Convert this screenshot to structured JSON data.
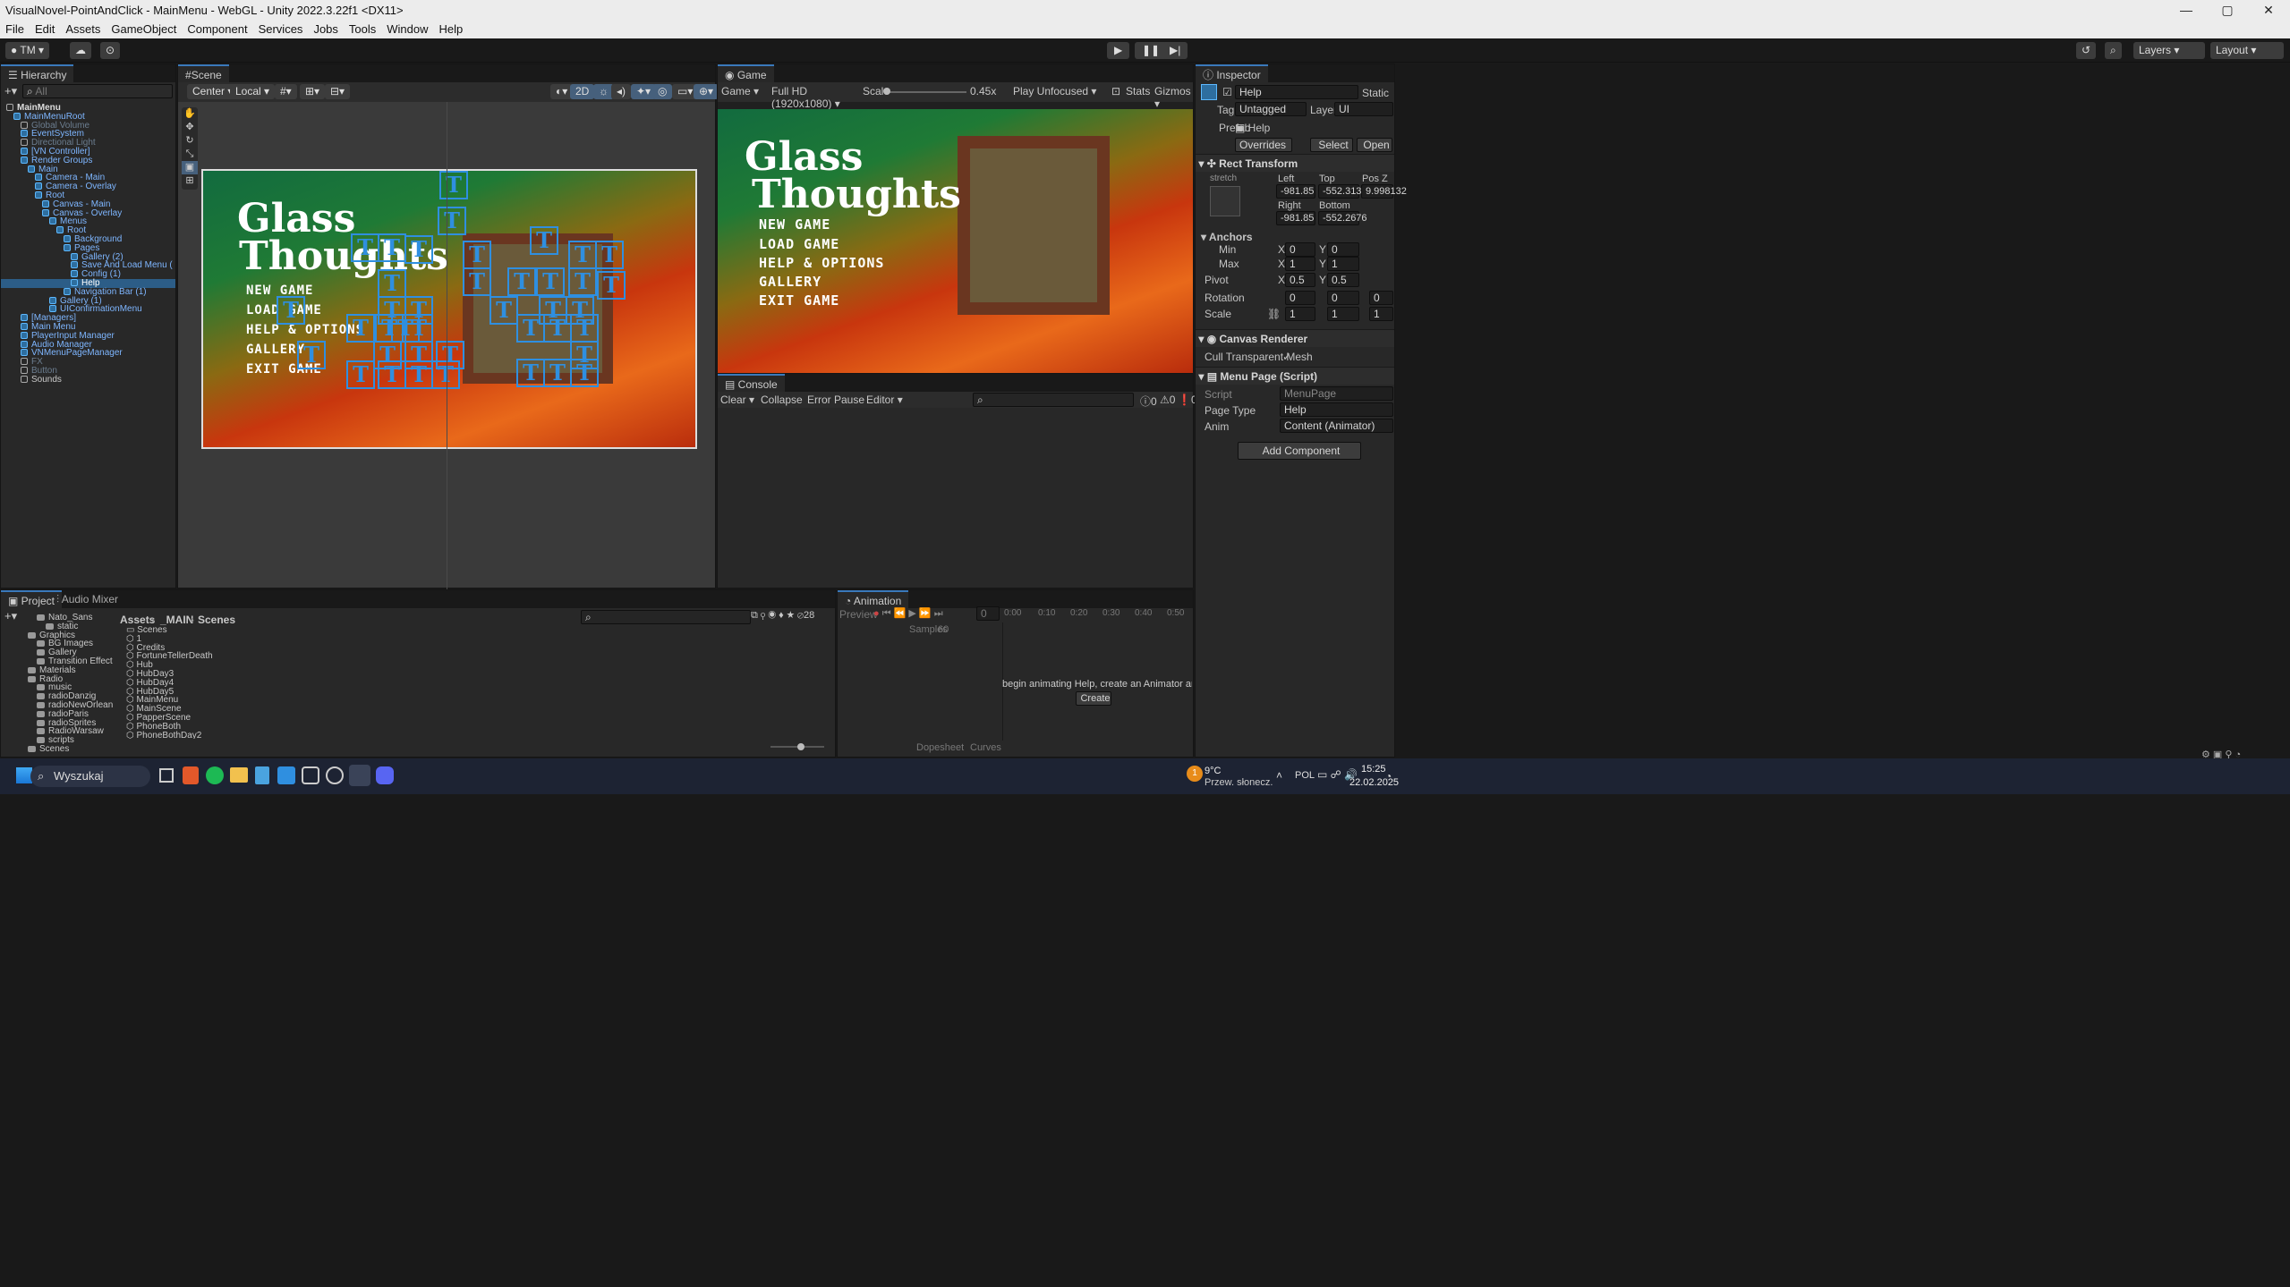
{
  "window": {
    "title": "VisualNovel-PointAndClick - MainMenu - WebGL - Unity 2022.3.22f1 <DX11>",
    "minimize": "—",
    "maximize": "▢",
    "close": "✕"
  },
  "menubar": [
    "File",
    "Edit",
    "Assets",
    "GameObject",
    "Component",
    "Services",
    "Jobs",
    "Tools",
    "Window",
    "Help"
  ],
  "toolbar": {
    "account": "TM",
    "layers": "Layers",
    "layout": "Layout"
  },
  "hierarchy": {
    "tab": "Hierarchy",
    "search_placeholder": "All",
    "items": [
      {
        "label": "MainMenu",
        "depth": 0,
        "type": "scene"
      },
      {
        "label": "MainMenuRoot",
        "depth": 1,
        "type": "prefab"
      },
      {
        "label": "Global Volume",
        "depth": 2,
        "type": "dim"
      },
      {
        "label": "EventSystem",
        "depth": 2,
        "type": "prefab"
      },
      {
        "label": "Directional Light",
        "depth": 2,
        "type": "dim"
      },
      {
        "label": "[VN Controller]",
        "depth": 2,
        "type": "prefab"
      },
      {
        "label": "Render Groups",
        "depth": 2,
        "type": "prefab"
      },
      {
        "label": "Main",
        "depth": 3,
        "type": "prefab"
      },
      {
        "label": "Camera - Main",
        "depth": 4,
        "type": "prefab"
      },
      {
        "label": "Camera - Overlay",
        "depth": 4,
        "type": "prefab"
      },
      {
        "label": "Root",
        "depth": 4,
        "type": "prefab"
      },
      {
        "label": "Canvas - Main",
        "depth": 5,
        "type": "prefab"
      },
      {
        "label": "Canvas - Overlay",
        "depth": 5,
        "type": "prefab"
      },
      {
        "label": "Menus",
        "depth": 6,
        "type": "prefab"
      },
      {
        "label": "Root",
        "depth": 7,
        "type": "prefab"
      },
      {
        "label": "Background",
        "depth": 8,
        "type": "prefab"
      },
      {
        "label": "Pages",
        "depth": 8,
        "type": "prefab"
      },
      {
        "label": "Gallery (2)",
        "depth": 9,
        "type": "prefab"
      },
      {
        "label": "Save And Load Menu (",
        "depth": 9,
        "type": "prefab"
      },
      {
        "label": "Config (1)",
        "depth": 9,
        "type": "prefab"
      },
      {
        "label": "Help",
        "depth": 9,
        "type": "selected"
      },
      {
        "label": "Navigation Bar (1)",
        "depth": 8,
        "type": "prefab"
      },
      {
        "label": "Gallery (1)",
        "depth": 6,
        "type": "prefab"
      },
      {
        "label": "UIConfirmationMenu",
        "depth": 6,
        "type": "prefab"
      },
      {
        "label": "[Managers]",
        "depth": 2,
        "type": "prefab"
      },
      {
        "label": "Main Menu",
        "depth": 2,
        "type": "prefab"
      },
      {
        "label": "PlayerInput Manager",
        "depth": 2,
        "type": "prefab"
      },
      {
        "label": "Audio Manager",
        "depth": 2,
        "type": "prefab"
      },
      {
        "label": "VNMenuPageManager",
        "depth": 2,
        "type": "prefab"
      },
      {
        "label": "FX",
        "depth": 2,
        "type": "dim"
      },
      {
        "label": "Button",
        "depth": 2,
        "type": "dim"
      },
      {
        "label": "Sounds",
        "depth": 2,
        "type": "normal"
      }
    ]
  },
  "scene": {
    "tab": "Scene",
    "pivot": "Center",
    "space": "Local",
    "mode2d": "2D"
  },
  "game": {
    "tab": "Game",
    "display": "Game",
    "resolution": "Full HD (1920x1080)",
    "scale_label": "Scale",
    "scale_value": "0.45x",
    "play_mode": "Play Unfocused",
    "stats": "Stats",
    "gizmos": "Gizmos"
  },
  "menu": {
    "title_line1": "Glass",
    "title_line2": "Thoughts",
    "items": [
      "NEW GAME",
      "LOAD GAME",
      "HELP & OPTIONS",
      "GALLERY",
      "EXIT GAME"
    ]
  },
  "inspector": {
    "tab": "Inspector",
    "name": "Help",
    "static": "Static",
    "tag_label": "Tag",
    "tag": "Untagged",
    "layer_label": "Layer",
    "layer": "UI",
    "prefab_label": "Prefab",
    "prefab": "Help",
    "overrides": "Overrides",
    "select": "Select",
    "open": "Open",
    "rect": {
      "title": "Rect Transform",
      "stretch": "stretch",
      "left_l": "Left",
      "top_l": "Top",
      "posz_l": "Pos Z",
      "left": "-981.85",
      "top": "-552.3135",
      "posz": "9.998132",
      "right_l": "Right",
      "bottom_l": "Bottom",
      "right": "-981.85",
      "bottom": "-552.2676",
      "anchors": "Anchors",
      "min": "Min",
      "max": "Max",
      "min_x": "0",
      "min_y": "0",
      "max_x": "1",
      "max_y": "1",
      "pivot": "Pivot",
      "pivot_x": "0.5",
      "pivot_y": "0.5",
      "rotation": "Rotation",
      "rot_x": "0",
      "rot_y": "0",
      "rot_z": "0",
      "scale": "Scale",
      "scale_x": "1",
      "scale_y": "1",
      "scale_z": "1"
    },
    "canvas_renderer": {
      "title": "Canvas Renderer",
      "cull": "Cull Transparent Mesh"
    },
    "menu_page": {
      "title": "Menu Page (Script)",
      "script_l": "Script",
      "script": "MenuPage",
      "page_type_l": "Page Type",
      "page_type": "Help",
      "anim_l": "Anim",
      "anim": "Content (Animator)"
    },
    "add_component": "Add Component"
  },
  "console": {
    "tab": "Console",
    "clear": "Clear",
    "collapse": "Collapse",
    "error_pause": "Error Pause",
    "editor": "Editor",
    "counts": [
      "0",
      "0",
      "0"
    ]
  },
  "project": {
    "tab": "Project",
    "audio_tab": "Audio Mixer",
    "tree": [
      {
        "label": "Nato_Sans",
        "depth": 1
      },
      {
        "label": "static",
        "depth": 2
      },
      {
        "label": "Graphics",
        "depth": 0
      },
      {
        "label": "BG Images",
        "depth": 1
      },
      {
        "label": "Gallery",
        "depth": 1
      },
      {
        "label": "Transition Effects",
        "depth": 1
      },
      {
        "label": "Materials",
        "depth": 0
      },
      {
        "label": "Radio",
        "depth": 0
      },
      {
        "label": "music",
        "depth": 1
      },
      {
        "label": "radioDanzig",
        "depth": 1
      },
      {
        "label": "radioNewOrleans",
        "depth": 1
      },
      {
        "label": "radioParis",
        "depth": 1
      },
      {
        "label": "radioSprites",
        "depth": 1
      },
      {
        "label": "RadioWarsaw",
        "depth": 1
      },
      {
        "label": "scripts",
        "depth": 1
      },
      {
        "label": "Scenes",
        "depth": 0
      }
    ],
    "breadcrumb": [
      "Assets",
      "_MAIN",
      "Scenes"
    ],
    "files": [
      "Scenes",
      "1",
      "Credits",
      "FortuneTellerDeath",
      "Hub",
      "HubDay3",
      "HubDay4",
      "HubDay5",
      "MainMenu",
      "MainScene",
      "PapperScene",
      "PhoneBoth",
      "PhoneBothDay2"
    ],
    "count": "28"
  },
  "animation": {
    "tab": "Animation",
    "preview": "Preview",
    "samples_l": "Samples",
    "samples": "60",
    "frame": "0",
    "times": [
      "0:00",
      "0:10",
      "0:20",
      "0:30",
      "0:40",
      "0:50"
    ],
    "message": "begin animating Help, create an Animator and an Animation C",
    "create": "Create",
    "dopesheet": "Dopesheet",
    "curves": "Curves"
  },
  "taskbar": {
    "search": "Wyszukaj",
    "weather_temp": "9°C",
    "weather_desc": "Przew. słonecz.",
    "lang": "POL",
    "time": "15:25",
    "date": "22.02.2025",
    "badge": "1"
  }
}
